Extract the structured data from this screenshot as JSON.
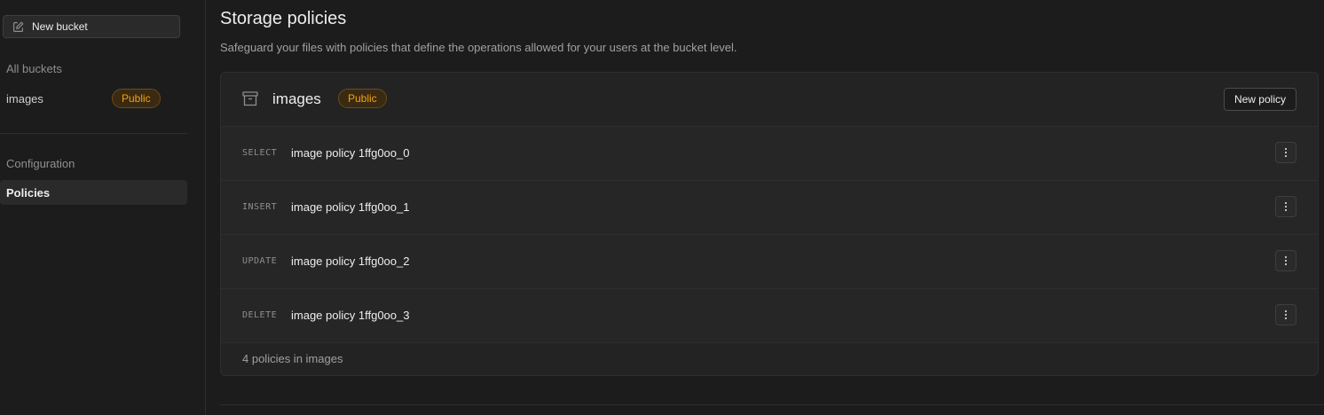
{
  "sidebar": {
    "new_bucket_label": "New bucket",
    "all_buckets_label": "All buckets",
    "buckets": [
      {
        "name": "images",
        "badge": "Public"
      }
    ],
    "nav": [
      {
        "label": "Configuration",
        "active": false
      },
      {
        "label": "Policies",
        "active": true
      }
    ]
  },
  "main": {
    "title": "Storage policies",
    "subtitle": "Safeguard your files with policies that define the operations allowed for your users at the bucket level.",
    "bucket_card": {
      "name": "images",
      "badge": "Public",
      "new_policy_label": "New policy",
      "policies": [
        {
          "operation": "SELECT",
          "name": "image policy 1ffg0oo_0"
        },
        {
          "operation": "INSERT",
          "name": "image policy 1ffg0oo_1"
        },
        {
          "operation": "UPDATE",
          "name": "image policy 1ffg0oo_2"
        },
        {
          "operation": "DELETE",
          "name": "image policy 1ffg0oo_3"
        }
      ],
      "footer": "4 policies in images"
    }
  },
  "colors": {
    "background": "#1c1c1c",
    "card": "#232323",
    "badge_text": "#f1a10d"
  },
  "icons": [
    "edit-icon",
    "archive-icon",
    "more-vertical-icon"
  ]
}
